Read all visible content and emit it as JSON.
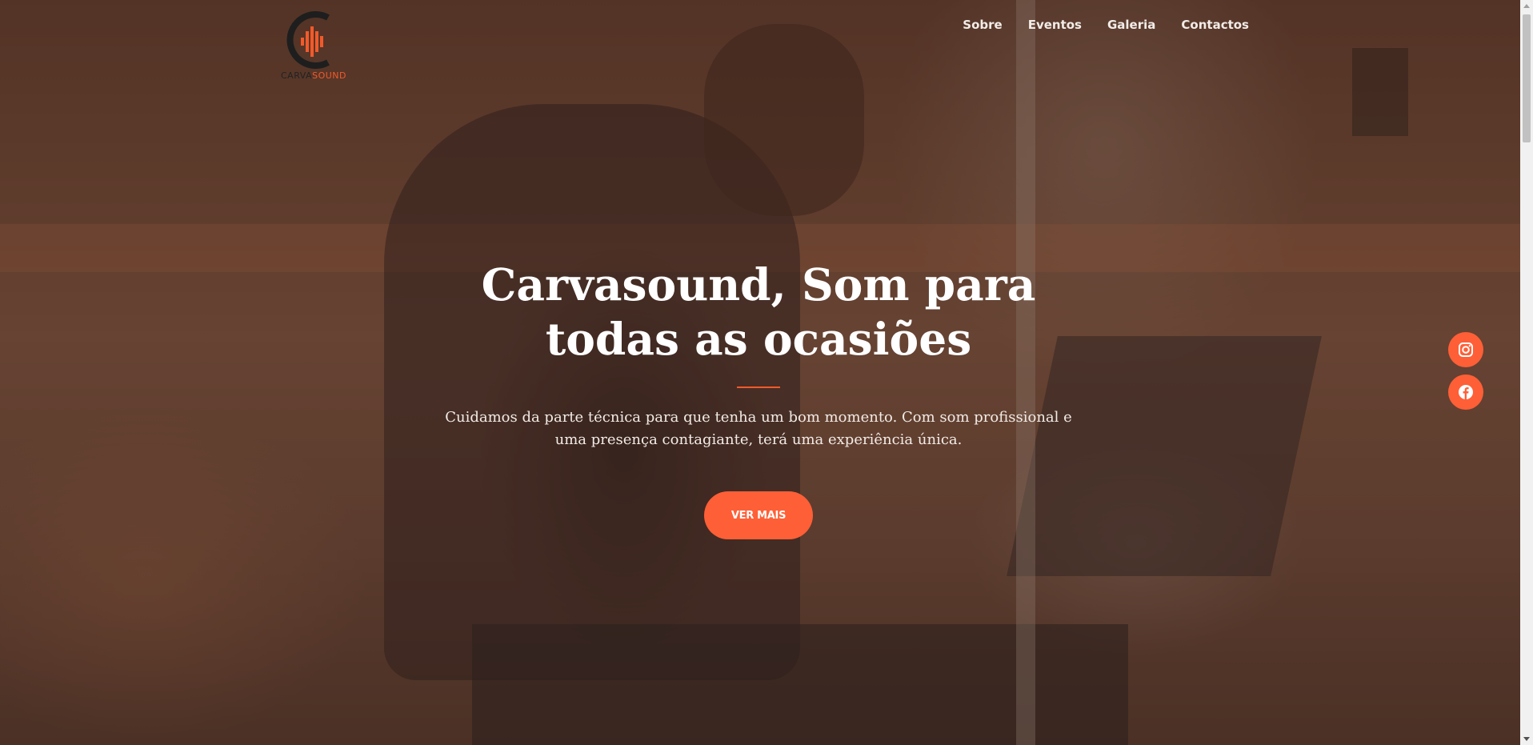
{
  "brand": {
    "logo_part1": "CARVA",
    "logo_part2": "SOUND",
    "accent_color": "#ff5f36"
  },
  "nav": {
    "items": [
      {
        "label": "Sobre"
      },
      {
        "label": "Eventos"
      },
      {
        "label": "Galeria"
      },
      {
        "label": "Contactos"
      }
    ]
  },
  "hero": {
    "title": "Carvasound, Som para todas as ocasiões",
    "subtitle": "Cuidamos da parte técnica para que tenha um bom momento. Com som profissional e uma presença contagiante, terá uma experiência única.",
    "cta_label": "VER MAIS"
  },
  "social": {
    "icons": [
      "instagram-icon",
      "facebook-icon"
    ]
  }
}
